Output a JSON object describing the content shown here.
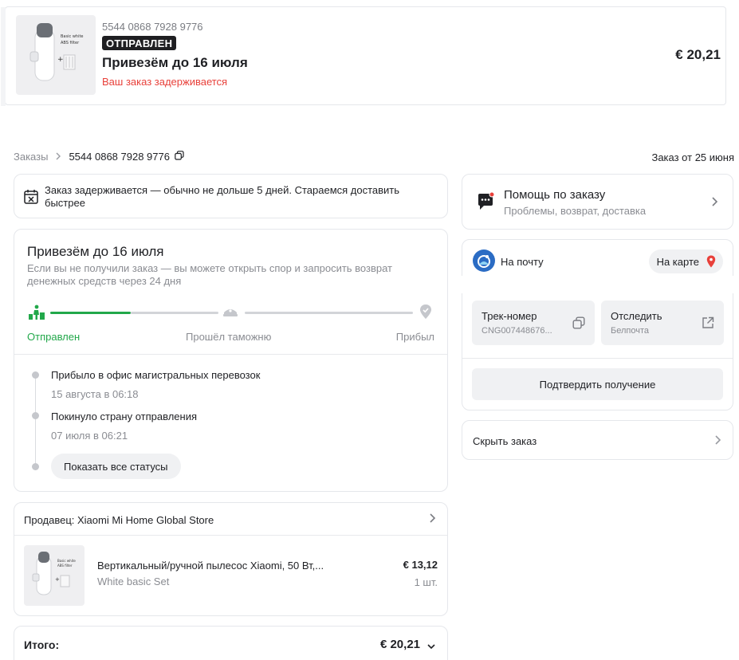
{
  "top_card": {
    "order_number": "5544 0868 7928 9776",
    "status_badge": "ОТПРАВЛЕН",
    "delivery_title": "Привезём до 16 июля",
    "delay_text": "Ваш заказ задерживается",
    "price": "€ 20,21",
    "thumb_line1": "Basic white",
    "thumb_line2": "ABS filter"
  },
  "breadcrumb": {
    "orders": "Заказы",
    "order_number": "5544 0868 7928 9776"
  },
  "order_date": "Заказ от 25 июня",
  "delay_notice": "Заказ задерживается — обычно не дольше 5 дней. Стараемся доставить быстрее",
  "tracking": {
    "title": "Привезём до 16 июля",
    "description": "Если вы не получили заказ — вы можете открыть спор и запросить возврат денежных средств через 24 дня",
    "progress_fraction": 0.25,
    "stages": [
      "Отправлен",
      "Прошёл таможню",
      "Прибыл"
    ],
    "events": [
      {
        "title": "Прибыло в офис магистральных перевозок",
        "date": "15 августа в 06:18"
      },
      {
        "title": "Покинуло страну отправления",
        "date": "07 июля в 06:21"
      }
    ],
    "show_all_label": "Показать все статусы"
  },
  "seller": {
    "label": "Продавец: Xiaomi Mi Home Global Store",
    "product_name": "Вертикальный/ручной пылесос Xiaomi, 50 Вт,...",
    "variant": "White basic Set",
    "price": "€ 13,12",
    "qty": "1 шт.",
    "thumb_line1": "Basic white",
    "thumb_line2": "ABS filter"
  },
  "total": {
    "label": "Итого:",
    "value": "€ 20,21"
  },
  "help": {
    "title": "Помощь по заказу",
    "subtitle": "Проблемы, возврат, доставка"
  },
  "post": {
    "name": "На почту",
    "map_label": "На карте",
    "track_title": "Трек-номер",
    "track_value": "CNG007448676...",
    "follow_title": "Отследить",
    "follow_value": "Белпочта",
    "confirm_label": "Подтвердить получение"
  },
  "hide_order": "Скрыть заказ",
  "colors": {
    "accent_green": "#22a84a",
    "alert_red": "#e8403a",
    "badge_bg": "#1f1f22",
    "post_blue": "#2b6cc4"
  }
}
